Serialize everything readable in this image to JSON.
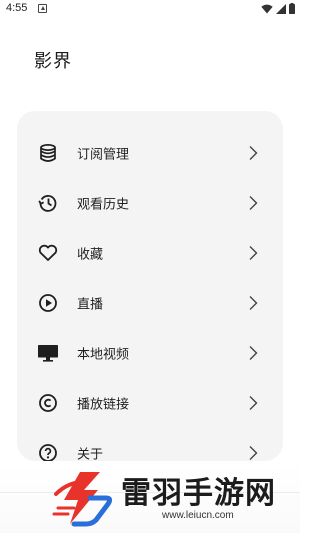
{
  "status_bar": {
    "time": "4:55",
    "icons": [
      "notification-icon",
      "wifi-icon",
      "signal-icon",
      "battery-icon"
    ]
  },
  "header": {
    "title": "影界"
  },
  "menu": {
    "items": [
      {
        "label": "订阅管理",
        "icon": "database-icon"
      },
      {
        "label": "观看历史",
        "icon": "history-icon"
      },
      {
        "label": "收藏",
        "icon": "heart-icon"
      },
      {
        "label": "直播",
        "icon": "play-circle-icon"
      },
      {
        "label": "本地视频",
        "icon": "monitor-icon"
      },
      {
        "label": "播放链接",
        "icon": "copyright-icon"
      },
      {
        "label": "关于",
        "icon": "help-circle-icon"
      }
    ]
  },
  "watermark": {
    "text": "雷羽手游网",
    "url": "www.leiucn.com",
    "colors": {
      "red": "#e8332a",
      "blue": "#2a6fd9"
    }
  }
}
